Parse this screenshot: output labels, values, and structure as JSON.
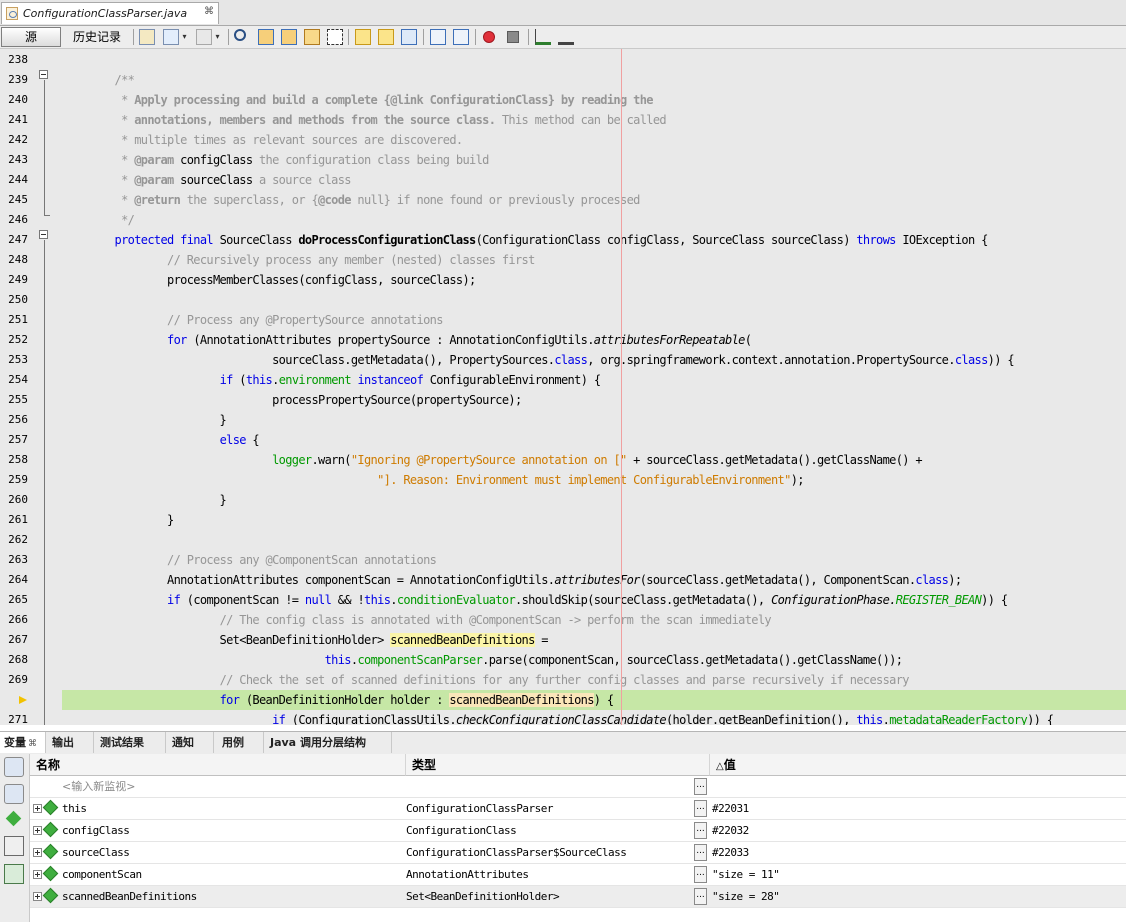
{
  "editor_tab": {
    "filename": "ConfigurationClassParser.java",
    "close_glyph": "⌘"
  },
  "toolbar": {
    "source_label": "源",
    "history_label": "历史记录"
  },
  "code_lines": [
    {
      "n": "238",
      "segs": []
    },
    {
      "n": "239",
      "segs": [
        {
          "t": "        ",
          "c": ""
        },
        {
          "t": "/**",
          "c": "c"
        }
      ]
    },
    {
      "n": "240",
      "segs": [
        {
          "t": "         * ",
          "c": "c"
        },
        {
          "t": "Apply processing and build a complete {@link ConfigurationClass} by reading the",
          "c": "cb"
        }
      ]
    },
    {
      "n": "241",
      "segs": [
        {
          "t": "         * ",
          "c": "c"
        },
        {
          "t": "annotations, members and methods from the source class.",
          "c": "cb"
        },
        {
          "t": " This method can be called",
          "c": "c"
        }
      ]
    },
    {
      "n": "242",
      "segs": [
        {
          "t": "         * multiple times as relevant sources are discovered.",
          "c": "c"
        }
      ]
    },
    {
      "n": "243",
      "segs": [
        {
          "t": "         * ",
          "c": "c"
        },
        {
          "t": "@param",
          "c": "cb"
        },
        {
          "t": " configClass",
          "c": ""
        },
        {
          "t": " the configuration class being build",
          "c": "c"
        }
      ]
    },
    {
      "n": "244",
      "segs": [
        {
          "t": "         * ",
          "c": "c"
        },
        {
          "t": "@param",
          "c": "cb"
        },
        {
          "t": " sourceClass",
          "c": ""
        },
        {
          "t": " a source class",
          "c": "c"
        }
      ]
    },
    {
      "n": "245",
      "segs": [
        {
          "t": "         * ",
          "c": "c"
        },
        {
          "t": "@return",
          "c": "cb"
        },
        {
          "t": " the superclass, or {",
          "c": "c"
        },
        {
          "t": "@code",
          "c": "cb"
        },
        {
          "t": " null} if none found or previously processed",
          "c": "c"
        }
      ]
    },
    {
      "n": "246",
      "segs": [
        {
          "t": "         */",
          "c": "c"
        }
      ]
    },
    {
      "n": "247",
      "segs": [
        {
          "t": "        ",
          "c": ""
        },
        {
          "t": "protected final",
          "c": "k"
        },
        {
          "t": " SourceClass ",
          "c": ""
        },
        {
          "t": "doProcessConfigurationClass",
          "c": "b"
        },
        {
          "t": "(ConfigurationClass configClass, SourceClass sourceClass) ",
          "c": ""
        },
        {
          "t": "throws",
          "c": "k"
        },
        {
          "t": " IOException {",
          "c": ""
        }
      ]
    },
    {
      "n": "248",
      "segs": [
        {
          "t": "                ",
          "c": ""
        },
        {
          "t": "// Recursively process any member (nested) classes first",
          "c": "c"
        }
      ]
    },
    {
      "n": "249",
      "segs": [
        {
          "t": "                processMemberClasses(configClass, sourceClass);",
          "c": ""
        }
      ]
    },
    {
      "n": "250",
      "segs": []
    },
    {
      "n": "251",
      "segs": [
        {
          "t": "                ",
          "c": ""
        },
        {
          "t": "// Process any @PropertySource annotations",
          "c": "c"
        }
      ]
    },
    {
      "n": "252",
      "segs": [
        {
          "t": "                ",
          "c": ""
        },
        {
          "t": "for",
          "c": "k"
        },
        {
          "t": " (AnnotationAttributes propertySource : AnnotationConfigUtils.",
          "c": ""
        },
        {
          "t": "attributesForRepeatable",
          "c": "i"
        },
        {
          "t": "(",
          "c": ""
        }
      ]
    },
    {
      "n": "253",
      "segs": [
        {
          "t": "                                sourceClass.getMetadata(), PropertySources.",
          "c": ""
        },
        {
          "t": "class",
          "c": "k"
        },
        {
          "t": ", org.springframework.context.annotation.PropertySource.",
          "c": ""
        },
        {
          "t": "class",
          "c": "k"
        },
        {
          "t": ")) {",
          "c": ""
        }
      ]
    },
    {
      "n": "254",
      "segs": [
        {
          "t": "                        ",
          "c": ""
        },
        {
          "t": "if",
          "c": "k"
        },
        {
          "t": " (",
          "c": ""
        },
        {
          "t": "this",
          "c": "k"
        },
        {
          "t": ".",
          "c": ""
        },
        {
          "t": "environment",
          "c": "f"
        },
        {
          "t": " ",
          "c": ""
        },
        {
          "t": "instanceof",
          "c": "k"
        },
        {
          "t": " ConfigurableEnvironment) {",
          "c": ""
        }
      ]
    },
    {
      "n": "255",
      "segs": [
        {
          "t": "                                processPropertySource(propertySource);",
          "c": ""
        }
      ]
    },
    {
      "n": "256",
      "segs": [
        {
          "t": "                        }",
          "c": ""
        }
      ]
    },
    {
      "n": "257",
      "segs": [
        {
          "t": "                        ",
          "c": ""
        },
        {
          "t": "else",
          "c": "k"
        },
        {
          "t": " {",
          "c": ""
        }
      ]
    },
    {
      "n": "258",
      "segs": [
        {
          "t": "                                ",
          "c": ""
        },
        {
          "t": "logger",
          "c": "f"
        },
        {
          "t": ".warn(",
          "c": ""
        },
        {
          "t": "\"Ignoring @PropertySource annotation on [\"",
          "c": "s"
        },
        {
          "t": " + sourceClass.getMetadata().getClassName() +",
          "c": ""
        }
      ]
    },
    {
      "n": "259",
      "segs": [
        {
          "t": "                                                ",
          "c": ""
        },
        {
          "t": "\"]. Reason: Environment must implement ConfigurableEnvironment\"",
          "c": "s"
        },
        {
          "t": ");",
          "c": ""
        }
      ]
    },
    {
      "n": "260",
      "segs": [
        {
          "t": "                        }",
          "c": ""
        }
      ]
    },
    {
      "n": "261",
      "segs": [
        {
          "t": "                }",
          "c": ""
        }
      ]
    },
    {
      "n": "262",
      "segs": []
    },
    {
      "n": "263",
      "segs": [
        {
          "t": "                ",
          "c": ""
        },
        {
          "t": "// Process any @ComponentScan annotations",
          "c": "c"
        }
      ]
    },
    {
      "n": "264",
      "segs": [
        {
          "t": "                AnnotationAttributes componentScan = AnnotationConfigUtils.",
          "c": ""
        },
        {
          "t": "attributesFor",
          "c": "i"
        },
        {
          "t": "(sourceClass.getMetadata(), ComponentScan.",
          "c": ""
        },
        {
          "t": "class",
          "c": "k"
        },
        {
          "t": ");",
          "c": ""
        }
      ]
    },
    {
      "n": "265",
      "segs": [
        {
          "t": "                ",
          "c": ""
        },
        {
          "t": "if",
          "c": "k"
        },
        {
          "t": " (componentScan != ",
          "c": ""
        },
        {
          "t": "null",
          "c": "k"
        },
        {
          "t": " && !",
          "c": ""
        },
        {
          "t": "this",
          "c": "k"
        },
        {
          "t": ".",
          "c": ""
        },
        {
          "t": "conditionEvaluator",
          "c": "f"
        },
        {
          "t": ".shouldSkip(sourceClass.getMetadata(), ",
          "c": ""
        },
        {
          "t": "ConfigurationPhase.",
          "c": "i"
        },
        {
          "t": "REGISTER_BEAN",
          "c": "fi"
        },
        {
          "t": ")) {",
          "c": ""
        }
      ]
    },
    {
      "n": "266",
      "segs": [
        {
          "t": "                        ",
          "c": ""
        },
        {
          "t": "// The config class is annotated with @ComponentScan -> perform the scan immediately",
          "c": "c"
        }
      ]
    },
    {
      "n": "267",
      "segs": [
        {
          "t": "                        Set<BeanDefinitionHolder> ",
          "c": ""
        },
        {
          "t": "scannedBeanDefinitions",
          "c": "hl"
        },
        {
          "t": " =",
          "c": ""
        }
      ]
    },
    {
      "n": "268",
      "segs": [
        {
          "t": "                                        ",
          "c": ""
        },
        {
          "t": "this",
          "c": "k"
        },
        {
          "t": ".",
          "c": ""
        },
        {
          "t": "componentScanParser",
          "c": "f"
        },
        {
          "t": ".parse(componentScan, sourceClass.getMetadata().getClassName());",
          "c": ""
        }
      ]
    },
    {
      "n": "269",
      "segs": [
        {
          "t": "                        ",
          "c": ""
        },
        {
          "t": "// Check the set of scanned definitions for any further config classes and parse recursively if necessary",
          "c": "c"
        }
      ]
    },
    {
      "n": "270",
      "segs": [
        {
          "t": "                        ",
          "c": ""
        },
        {
          "t": "for",
          "c": "k"
        },
        {
          "t": " (BeanDefinitionHolder holder : ",
          "c": ""
        },
        {
          "t": "scannedBeanDefinitions",
          "c": "hl2"
        },
        {
          "t": ") {",
          "c": ""
        }
      ],
      "current": true
    },
    {
      "n": "271",
      "segs": [
        {
          "t": "                                ",
          "c": ""
        },
        {
          "t": "if",
          "c": "k"
        },
        {
          "t": " (ConfigurationClassUtils.",
          "c": ""
        },
        {
          "t": "checkConfigurationClassCandidate",
          "c": "i"
        },
        {
          "t": "(holder.getBeanDefinition(), ",
          "c": ""
        },
        {
          "t": "this",
          "c": "k"
        },
        {
          "t": ".",
          "c": ""
        },
        {
          "t": "metadataReaderFactory",
          "c": "f"
        },
        {
          "t": ")) {",
          "c": ""
        }
      ]
    }
  ],
  "bottom_tabs": [
    {
      "label": "变量",
      "active": true
    },
    {
      "label": "输出"
    },
    {
      "label": "测试结果"
    },
    {
      "label": "通知"
    },
    {
      "label": "用例"
    },
    {
      "label": "Java 调用分层结构"
    }
  ],
  "variables": {
    "columns": {
      "name": "名称",
      "type": "类型",
      "value": "值",
      "value_sort_glyph": "△"
    },
    "watch_placeholder": "<输入新监视>",
    "dots_glyph": "...",
    "rows": [
      {
        "name": "this",
        "type": "ConfigurationClassParser",
        "value": "#22031"
      },
      {
        "name": "configClass",
        "type": "ConfigurationClass",
        "value": "#22032"
      },
      {
        "name": "sourceClass",
        "type": "ConfigurationClassParser$SourceClass",
        "value": "#22033"
      },
      {
        "name": "componentScan",
        "type": "AnnotationAttributes",
        "value": "\"size = 11\""
      },
      {
        "name": "scannedBeanDefinitions",
        "type": "Set<BeanDefinitionHolder>",
        "value": "\"size = 28\"",
        "selected": true
      }
    ]
  }
}
